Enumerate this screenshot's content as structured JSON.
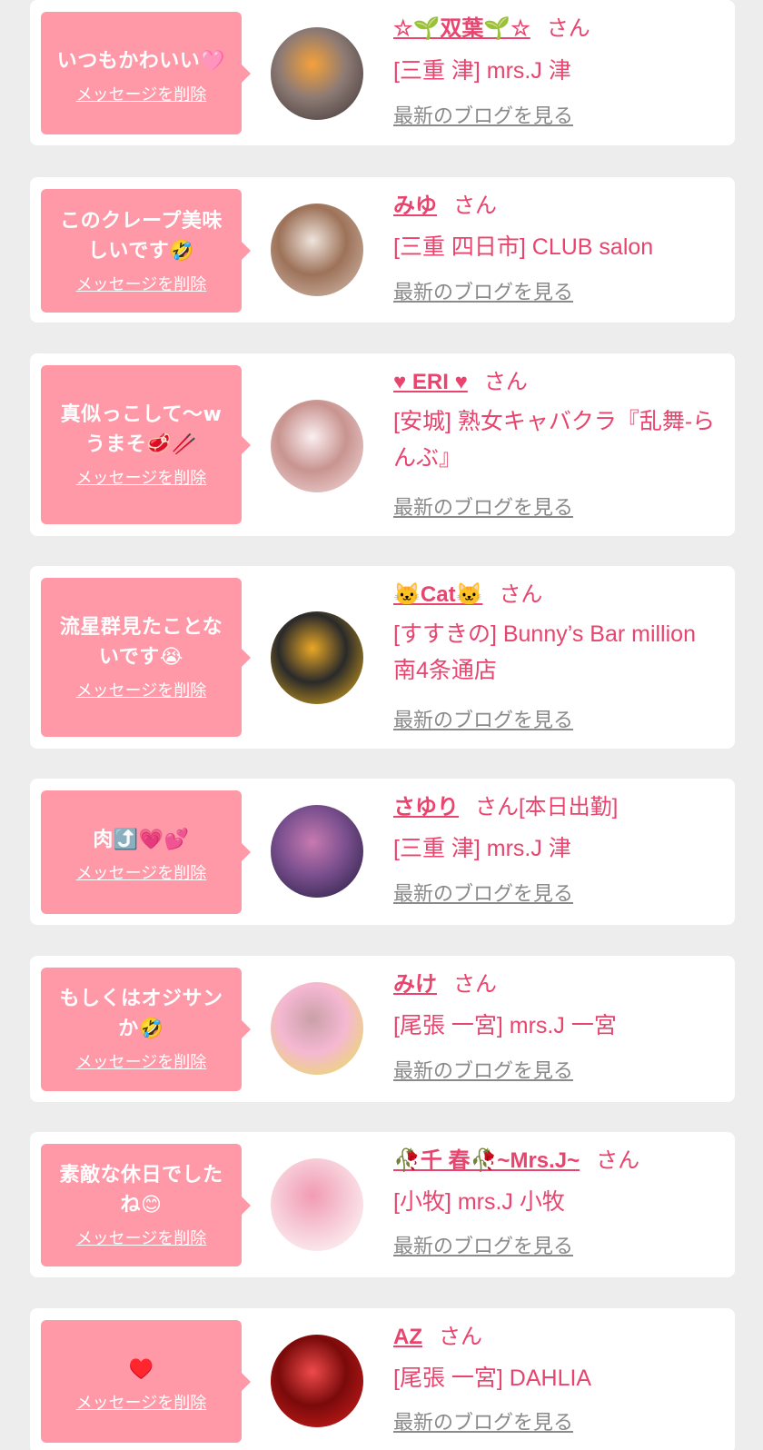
{
  "items": [
    {
      "message": "いつもかわいい🩷",
      "delete_label": "メッセージを削除",
      "name": "☆🌱双葉🌱☆",
      "honorific": "さん",
      "status": "",
      "shop": "[三重 津] mrs.J 津",
      "blog_label": "最新のブログを見る",
      "avatar_colors": [
        "#3b3132",
        "#8c7a74",
        "#f5a13a"
      ]
    },
    {
      "message": "このクレープ美味しいです🤣",
      "delete_label": "メッセージを削除",
      "name": "みゆ",
      "honorific": "さん",
      "status": "",
      "shop": "[三重 四日市] CLUB salon",
      "blog_label": "最新のブログを見る",
      "avatar_colors": [
        "#d8c2b5",
        "#9d7259",
        "#efe4dc"
      ]
    },
    {
      "message": "真似っこして〜w うまそ🥩🥢",
      "delete_label": "メッセージを削除",
      "name": "♥ ERI ♥",
      "honorific": "さん",
      "status": "",
      "shop": "[安城] 熟女キャバクラ『乱舞-らんぶ』",
      "blog_label": "最新のブログを見る",
      "avatar_colors": [
        "#f6dfe0",
        "#c89490",
        "#fbeff1"
      ]
    },
    {
      "message": "流星群見たことないです😭",
      "delete_label": "メッセージを削除",
      "name": "🐱Cat🐱",
      "honorific": "さん",
      "status": "",
      "shop": "[すすきの] Bunny’s Bar million 南4条通店",
      "blog_label": "最新のブログを見る",
      "avatar_colors": [
        "#f2b61b",
        "#2a2a2a",
        "#e9a826"
      ]
    },
    {
      "message": "肉⤴️💗💕",
      "delete_label": "メッセージを削除",
      "name": "さゆり",
      "honorific": "さん",
      "status": "[本日出勤]",
      "shop": "[三重 津] mrs.J 津",
      "blog_label": "最新のブログを見る",
      "avatar_colors": [
        "#1f1a3a",
        "#7a4f8e",
        "#c77ab0"
      ]
    },
    {
      "message": "もしくはオジサンか🤣",
      "delete_label": "メッセージを削除",
      "name": "みけ",
      "honorific": "さん",
      "status": "",
      "shop": "[尾張 一宮] mrs.J 一宮",
      "blog_label": "最新のブログを見る",
      "avatar_colors": [
        "#e7e34f",
        "#f5b8d2",
        "#c9a0a8"
      ]
    },
    {
      "message": "素敵な休日でしたね😊",
      "delete_label": "メッセージを削除",
      "name": "🥀千 春🥀~Mrs.J~",
      "honorific": "さん",
      "status": "",
      "shop": "[小牧] mrs.J 小牧",
      "blog_label": "最新のブログを見る",
      "avatar_colors": [
        "#ffffff",
        "#f6c9d5",
        "#f19bb4"
      ]
    },
    {
      "message": "♥️",
      "delete_label": "メッセージを削除",
      "name": "AZ",
      "honorific": "さん",
      "status": "",
      "shop": "[尾張 一宮] DAHLIA",
      "blog_label": "最新のブログを見る",
      "avatar_colors": [
        "#d91f1f",
        "#7a0a0a",
        "#ef4a4a"
      ]
    }
  ]
}
